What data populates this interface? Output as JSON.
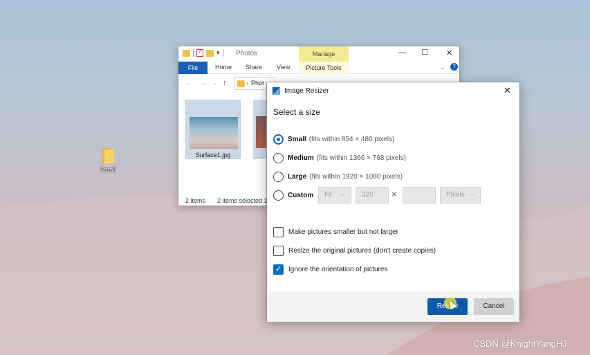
{
  "desktop": {
    "folder_label": "Small"
  },
  "explorer": {
    "title": "Photos",
    "context_tab_group": "Manage",
    "tabs": [
      "File",
      "Home",
      "Share",
      "View",
      "Picture Tools"
    ],
    "address": "Phot",
    "files": [
      {
        "name": "Surface1.jpg"
      },
      {
        "name": "S"
      }
    ],
    "status_count": "2 items",
    "status_selected": "2 items selected  1"
  },
  "dialog": {
    "title": "Image Resizer",
    "heading": "Select a size",
    "options": [
      {
        "name": "Small",
        "desc": "(fits within 854 × 480 pixels)",
        "selected": true
      },
      {
        "name": "Medium",
        "desc": "(fits within 1366 × 768 pixels)",
        "selected": false
      },
      {
        "name": "Large",
        "desc": "(fits within 1920 × 1080 pixels)",
        "selected": false
      },
      {
        "name": "Custom",
        "desc": "",
        "selected": false
      }
    ],
    "custom": {
      "fit": "Fit",
      "width": "320",
      "height": "",
      "unit": "Pixels",
      "times": "×"
    },
    "checkboxes": [
      {
        "label": "Make pictures smaller but not larger",
        "checked": false
      },
      {
        "label": "Resize the original pictures (don't create copies)",
        "checked": false
      },
      {
        "label": "Ignore the orientation of pictures",
        "checked": true
      }
    ],
    "resize_label": "Resize",
    "cancel_label": "Cancel"
  },
  "watermark": "CSDN @KnightYangHJ"
}
